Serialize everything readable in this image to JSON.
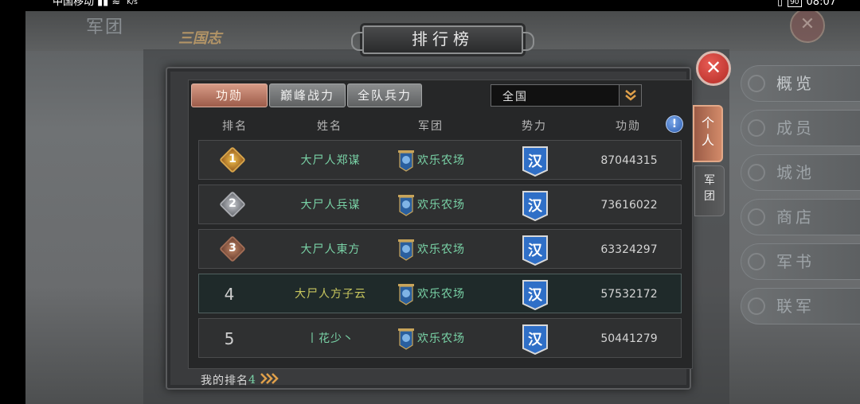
{
  "status_bar": {
    "carrier": "中国移动",
    "speed_unit": "K/s",
    "battery": "90",
    "time": "08:07"
  },
  "background": {
    "section_title": "军团",
    "game_logo": "三国志"
  },
  "side_menu": {
    "items": [
      {
        "label": "概览"
      },
      {
        "label": "成员"
      },
      {
        "label": "城池"
      },
      {
        "label": "商店"
      },
      {
        "label": "军书"
      },
      {
        "label": "联军"
      }
    ]
  },
  "dialog": {
    "title": "排行榜",
    "close_icon": "close-icon",
    "filter_tabs": [
      {
        "label": "功勋",
        "active": true
      },
      {
        "label": "巅峰战力",
        "active": false
      },
      {
        "label": "全队兵力",
        "active": false
      }
    ],
    "region_select": {
      "value": "全国"
    },
    "side_tabs": [
      {
        "label": "个人",
        "active": true
      },
      {
        "label": "军团",
        "active": false
      }
    ],
    "columns": [
      "排名",
      "姓名",
      "军团",
      "势力",
      "功勋"
    ],
    "info_icon_glyph": "!",
    "rows": [
      {
        "rank": "1",
        "name": "大尸人郑谋",
        "legion": "欢乐农场",
        "faction": "汉",
        "merit": "87044315"
      },
      {
        "rank": "2",
        "name": "大尸人兵谋",
        "legion": "欢乐农场",
        "faction": "汉",
        "merit": "73616022"
      },
      {
        "rank": "3",
        "name": "大尸人東方",
        "legion": "欢乐农场",
        "faction": "汉",
        "merit": "63324297"
      },
      {
        "rank": "4",
        "name": "大尸人方子云",
        "legion": "欢乐农场",
        "faction": "汉",
        "merit": "57532172"
      },
      {
        "rank": "5",
        "name": "丨花少丶",
        "legion": "欢乐农场",
        "faction": "汉",
        "merit": "50441279"
      }
    ],
    "my_rank": {
      "label": "我的排名",
      "value": "4"
    },
    "colors": {
      "active_tab": "#c7806a",
      "name_green": "#79d2a6",
      "highlight_name": "#c8c75e",
      "close_red": "#d9453e",
      "faction_blue": "#2f6fc7"
    }
  }
}
